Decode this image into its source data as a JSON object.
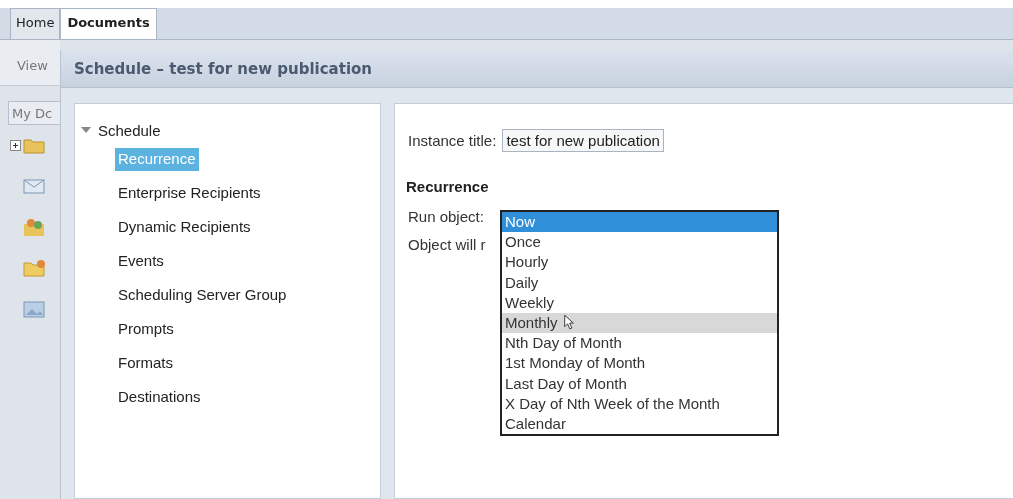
{
  "tabs": [
    {
      "label": "Home",
      "selected": false
    },
    {
      "label": "Documents",
      "selected": true
    }
  ],
  "left_strip": {
    "view_label": "View",
    "panel_tab": "My Dc"
  },
  "dialog": {
    "title": "Schedule – test for new publication",
    "nav": {
      "label": "Schedule",
      "expanded": true,
      "children": [
        {
          "label": "Recurrence",
          "selected": true
        },
        {
          "label": "Enterprise Recipients",
          "selected": false
        },
        {
          "label": "Dynamic Recipients",
          "selected": false
        },
        {
          "label": "Events",
          "selected": false
        },
        {
          "label": "Scheduling Server Group",
          "selected": false
        },
        {
          "label": "Prompts",
          "selected": false
        },
        {
          "label": "Formats",
          "selected": false
        },
        {
          "label": "Destinations",
          "selected": false
        }
      ]
    },
    "instance_title": {
      "label": "Instance title:",
      "value": "test for new publication"
    },
    "section_heading": "Recurrence",
    "run_object": {
      "label": "Run object:",
      "options": [
        {
          "label": "Now",
          "selected": true,
          "hovered": false
        },
        {
          "label": "Once",
          "selected": false,
          "hovered": false
        },
        {
          "label": "Hourly",
          "selected": false,
          "hovered": false
        },
        {
          "label": "Daily",
          "selected": false,
          "hovered": false
        },
        {
          "label": "Weekly",
          "selected": false,
          "hovered": false
        },
        {
          "label": "Monthly",
          "selected": false,
          "hovered": true
        },
        {
          "label": "Nth Day of Month",
          "selected": false,
          "hovered": false
        },
        {
          "label": "1st Monday of Month",
          "selected": false,
          "hovered": false
        },
        {
          "label": "Last Day of Month",
          "selected": false,
          "hovered": false
        },
        {
          "label": "X Day of Nth Week of the Month",
          "selected": false,
          "hovered": false
        },
        {
          "label": "Calendar",
          "selected": false,
          "hovered": false
        }
      ]
    },
    "run_note": "Object will r"
  }
}
